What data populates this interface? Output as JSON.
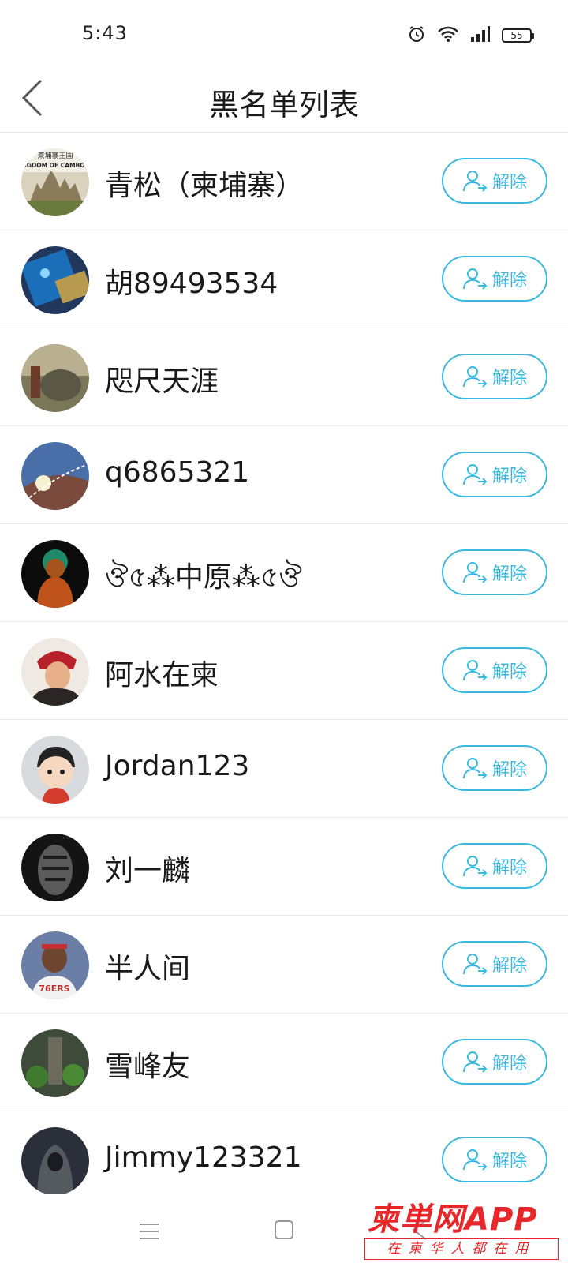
{
  "status_bar": {
    "time": "5:43",
    "battery": "55",
    "icons": [
      "alarm-icon",
      "wifi-icon",
      "signal-icon",
      "battery-icon"
    ]
  },
  "header": {
    "title": "黑名单列表",
    "back_icon": "chevron-left-icon"
  },
  "colors": {
    "accent": "#3bb8df",
    "divider": "#e8e8e8",
    "watermark": "#e8272a"
  },
  "blacklist": [
    {
      "name": "青松（柬埔寨）",
      "action": "解除",
      "avatar_text": "柬埔寨王国 NGDOM OF CAMBOL"
    },
    {
      "name": "胡89493534",
      "action": "解除"
    },
    {
      "name": "咫尺天涯",
      "action": "解除"
    },
    {
      "name": "q6865321",
      "action": "解除"
    },
    {
      "name": "ঔ৫⁂中原⁂৫ঔ",
      "action": "解除"
    },
    {
      "name": "阿水在柬",
      "action": "解除"
    },
    {
      "name": "Jordan123",
      "action": "解除"
    },
    {
      "name": "刘一麟",
      "action": "解除"
    },
    {
      "name": "半人间",
      "action": "解除"
    },
    {
      "name": "雪峰友",
      "action": "解除"
    },
    {
      "name": "Jimmy123321",
      "action": "解除"
    }
  ],
  "bottom_nav": {
    "icons": [
      "menu-icon",
      "home-icon",
      "back-icon"
    ]
  },
  "watermark": {
    "main": "柬単网APP",
    "sub": "在柬华人都在用"
  }
}
